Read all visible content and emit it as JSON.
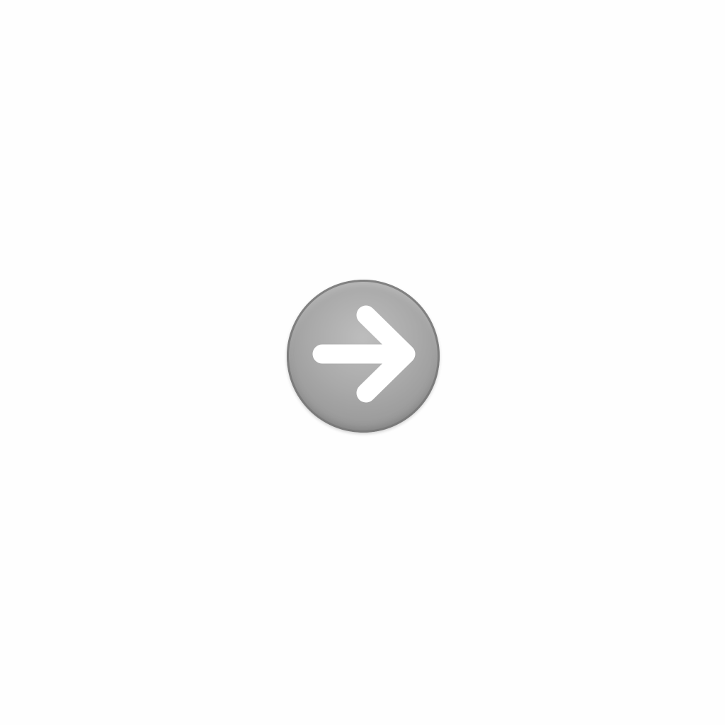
{
  "button": {
    "icon": "arrow-right-icon",
    "background_color": "#a6a6a6",
    "arrow_color": "#ffffff"
  }
}
